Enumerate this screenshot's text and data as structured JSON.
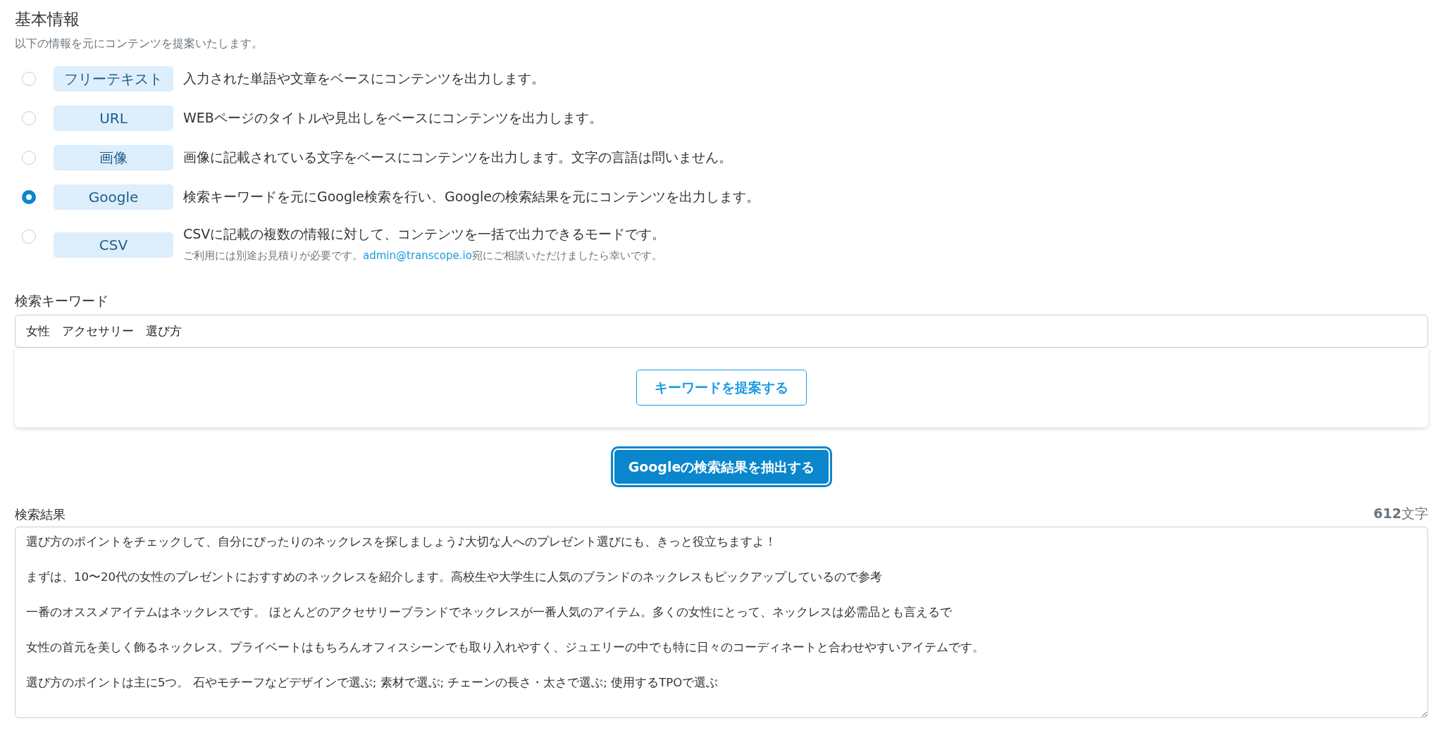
{
  "section": {
    "title": "基本情報",
    "subtitle": "以下の情報を元にコンテンツを提案いたします。"
  },
  "modes": [
    {
      "label": "フリーテキスト",
      "description": "入力された単語や文章をベースにコンテンツを出力します。",
      "selected": false
    },
    {
      "label": "URL",
      "description": "WEBページのタイトルや見出しをベースにコンテンツを出力します。",
      "selected": false
    },
    {
      "label": "画像",
      "description": "画像に記載されている文字をベースにコンテンツを出力します。文字の言語は問いません。",
      "selected": false
    },
    {
      "label": "Google",
      "description": "検索キーワードを元にGoogle検索を行い、Googleの検索結果を元にコンテンツを出力します。",
      "selected": true
    },
    {
      "label": "CSV",
      "description": "CSVに記載の複数の情報に対して、コンテンツを一括で出力できるモードです。",
      "note_before": "ご利用には別途お見積りが必要です。",
      "note_link": "admin@transcope.io",
      "note_after": "宛にご相談いただけましたら幸いです。",
      "selected": false
    }
  ],
  "keyword": {
    "label": "検索キーワード",
    "value": "女性　アクセサリー　選び方",
    "suggest_button": "キーワードを提案する"
  },
  "extract_button": "Googleの検索結果を抽出する",
  "results": {
    "label": "検索結果",
    "count": "**612**文字",
    "paragraphs": [
      "選び方のポイントをチェックして、自分にぴったりのネックレスを探しましょう♪大切な人へのプレゼント選びにも、きっと役立ちますよ！",
      "まずは、10〜20代の女性のプレゼントにおすすめのネックレスを紹介します。高校生や大学生に人気のブランドのネックレスもピックアップしているので参考",
      "一番のオススメアイテムはネックレスです。 ほとんどのアクセサリーブランドでネックレスが一番人気のアイテム。多くの女性にとって、ネックレスは必需品とも言えるで",
      "女性の首元を美しく飾るネックレス。プライベートはもちろんオフィスシーンでも取り入れやすく、ジュエリーの中でも特に日々のコーディネートと合わせやすいアイテムです。",
      "選び方のポイントは主に5つ。 石やモチーフなどデザインで選ぶ; 素材で選ぶ; チェーンの長さ・太さで選ぶ; 使用するTPOで選ぶ"
    ]
  }
}
